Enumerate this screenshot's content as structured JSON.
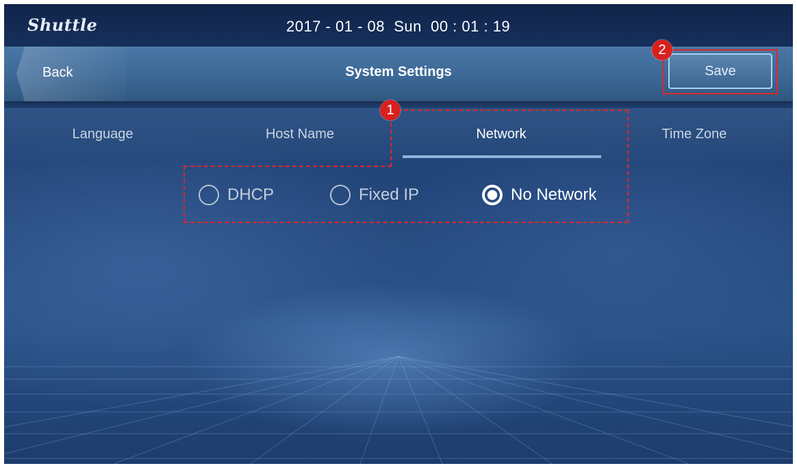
{
  "status_bar": {
    "brand": "Shuttle",
    "datetime": "2017 - 01 - 08  Sun  00 : 01 : 19"
  },
  "header": {
    "back_label": "Back",
    "title": "System Settings",
    "save_label": "Save"
  },
  "tabs": [
    {
      "label": "Language",
      "active": false
    },
    {
      "label": "Host Name",
      "active": false
    },
    {
      "label": "Network",
      "active": true
    },
    {
      "label": "Time Zone",
      "active": false
    }
  ],
  "network_options": [
    {
      "label": "DHCP",
      "selected": false
    },
    {
      "label": "Fixed IP",
      "selected": false
    },
    {
      "label": "No Network",
      "selected": true
    }
  ],
  "annotations": {
    "step1": "1",
    "step2": "2"
  },
  "colors": {
    "annotation_red": "#e0262b",
    "accent_underline": "#8cb6dd",
    "save_border": "#a9d6f4"
  }
}
